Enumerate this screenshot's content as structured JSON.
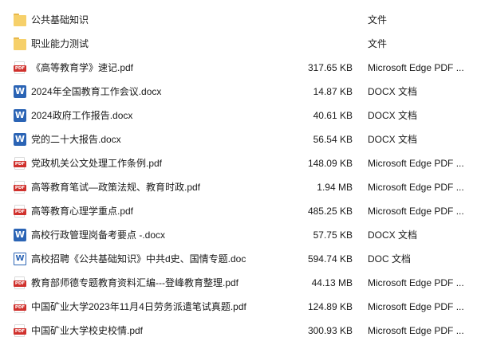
{
  "files": [
    {
      "icon": "folder-icon",
      "name": "公共基础知识",
      "size": "",
      "type": "文件"
    },
    {
      "icon": "folder-icon",
      "name": "职业能力测试",
      "size": "",
      "type": "文件"
    },
    {
      "icon": "pdf-icon",
      "name": "《高等教育学》速记.pdf",
      "size": "317.65 KB",
      "type": "Microsoft Edge PDF ..."
    },
    {
      "icon": "word-icon",
      "name": "2024年全国教育工作会议.docx",
      "size": "14.87 KB",
      "type": "DOCX 文档"
    },
    {
      "icon": "word-icon",
      "name": "2024政府工作报告.docx",
      "size": "40.61 KB",
      "type": "DOCX 文档"
    },
    {
      "icon": "word-icon",
      "name": "党的二十大报告.docx",
      "size": "56.54 KB",
      "type": "DOCX 文档"
    },
    {
      "icon": "pdf-icon",
      "name": "党政机关公文处理工作条例.pdf",
      "size": "148.09 KB",
      "type": "Microsoft Edge PDF ..."
    },
    {
      "icon": "pdf-icon",
      "name": "高等教育笔试—政策法规、教育时政.pdf",
      "size": "1.94 MB",
      "type": "Microsoft Edge PDF ..."
    },
    {
      "icon": "pdf-icon",
      "name": "高等教育心理学重点.pdf",
      "size": "485.25 KB",
      "type": "Microsoft Edge PDF ..."
    },
    {
      "icon": "word-icon",
      "name": "高校行政管理岗备考要点 -.docx",
      "size": "57.75 KB",
      "type": "DOCX 文档"
    },
    {
      "icon": "doc-icon",
      "name": "高校招聘《公共基础知识》中共d史、国情专题.doc",
      "size": "594.74 KB",
      "type": "DOC 文档"
    },
    {
      "icon": "pdf-icon",
      "name": "教育部师德专题教育资料汇编---登峰教育整理.pdf",
      "size": "44.13 MB",
      "type": "Microsoft Edge PDF ..."
    },
    {
      "icon": "pdf-icon",
      "name": "中国矿业大学2023年11月4日劳务派遣笔试真题.pdf",
      "size": "124.89 KB",
      "type": "Microsoft Edge PDF ..."
    },
    {
      "icon": "pdf-icon",
      "name": "中国矿业大学校史校情.pdf",
      "size": "300.93 KB",
      "type": "Microsoft Edge PDF ..."
    }
  ],
  "icon_labels": {
    "pdf": "PDF",
    "word": "W"
  },
  "colors": {
    "folder": "#f6d06a",
    "pdf": "#d0312d",
    "word": "#2b64b5"
  }
}
